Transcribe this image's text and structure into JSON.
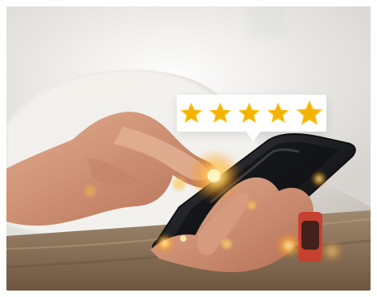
{
  "image": {
    "description_icons": {
      "stars": [
        "star-icon",
        "star-icon",
        "star-icon",
        "star-icon",
        "star-icon"
      ]
    },
    "colors": {
      "star": "#f4b300",
      "bubble": "#ffffff",
      "phone": "#1f2024",
      "shirt": "#f2f0ec",
      "skin": "#c98f72",
      "table": "#8c6c50",
      "watch_strap": "#d0402b",
      "glow": "#ffcf57"
    },
    "rating": {
      "value": 5,
      "max": 5
    }
  }
}
